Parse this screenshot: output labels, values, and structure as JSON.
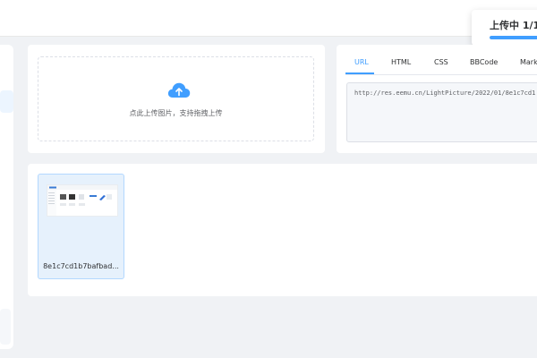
{
  "upload_progress": {
    "label": "上传中 1/1",
    "percent": 100,
    "color": "#409eff"
  },
  "upload": {
    "hint": "点此上传图片，支持拖拽上传",
    "icon": "cloud-upload-icon"
  },
  "link_panel": {
    "tabs": [
      {
        "label": "URL",
        "active": true
      },
      {
        "label": "HTML",
        "active": false
      },
      {
        "label": "CSS",
        "active": false
      },
      {
        "label": "BBCode",
        "active": false
      },
      {
        "label": "Mark",
        "active": false
      }
    ],
    "value": "http://res.eemu.cn/LightPicture/2022/01/8e1c7cd1"
  },
  "gallery": {
    "items": [
      {
        "name": "8e1c7cd1b7bafbad...",
        "selected": true
      }
    ]
  },
  "colors": {
    "accent": "#409eff",
    "background": "#f0f2f5",
    "selected_bg": "#e6f1fc"
  }
}
